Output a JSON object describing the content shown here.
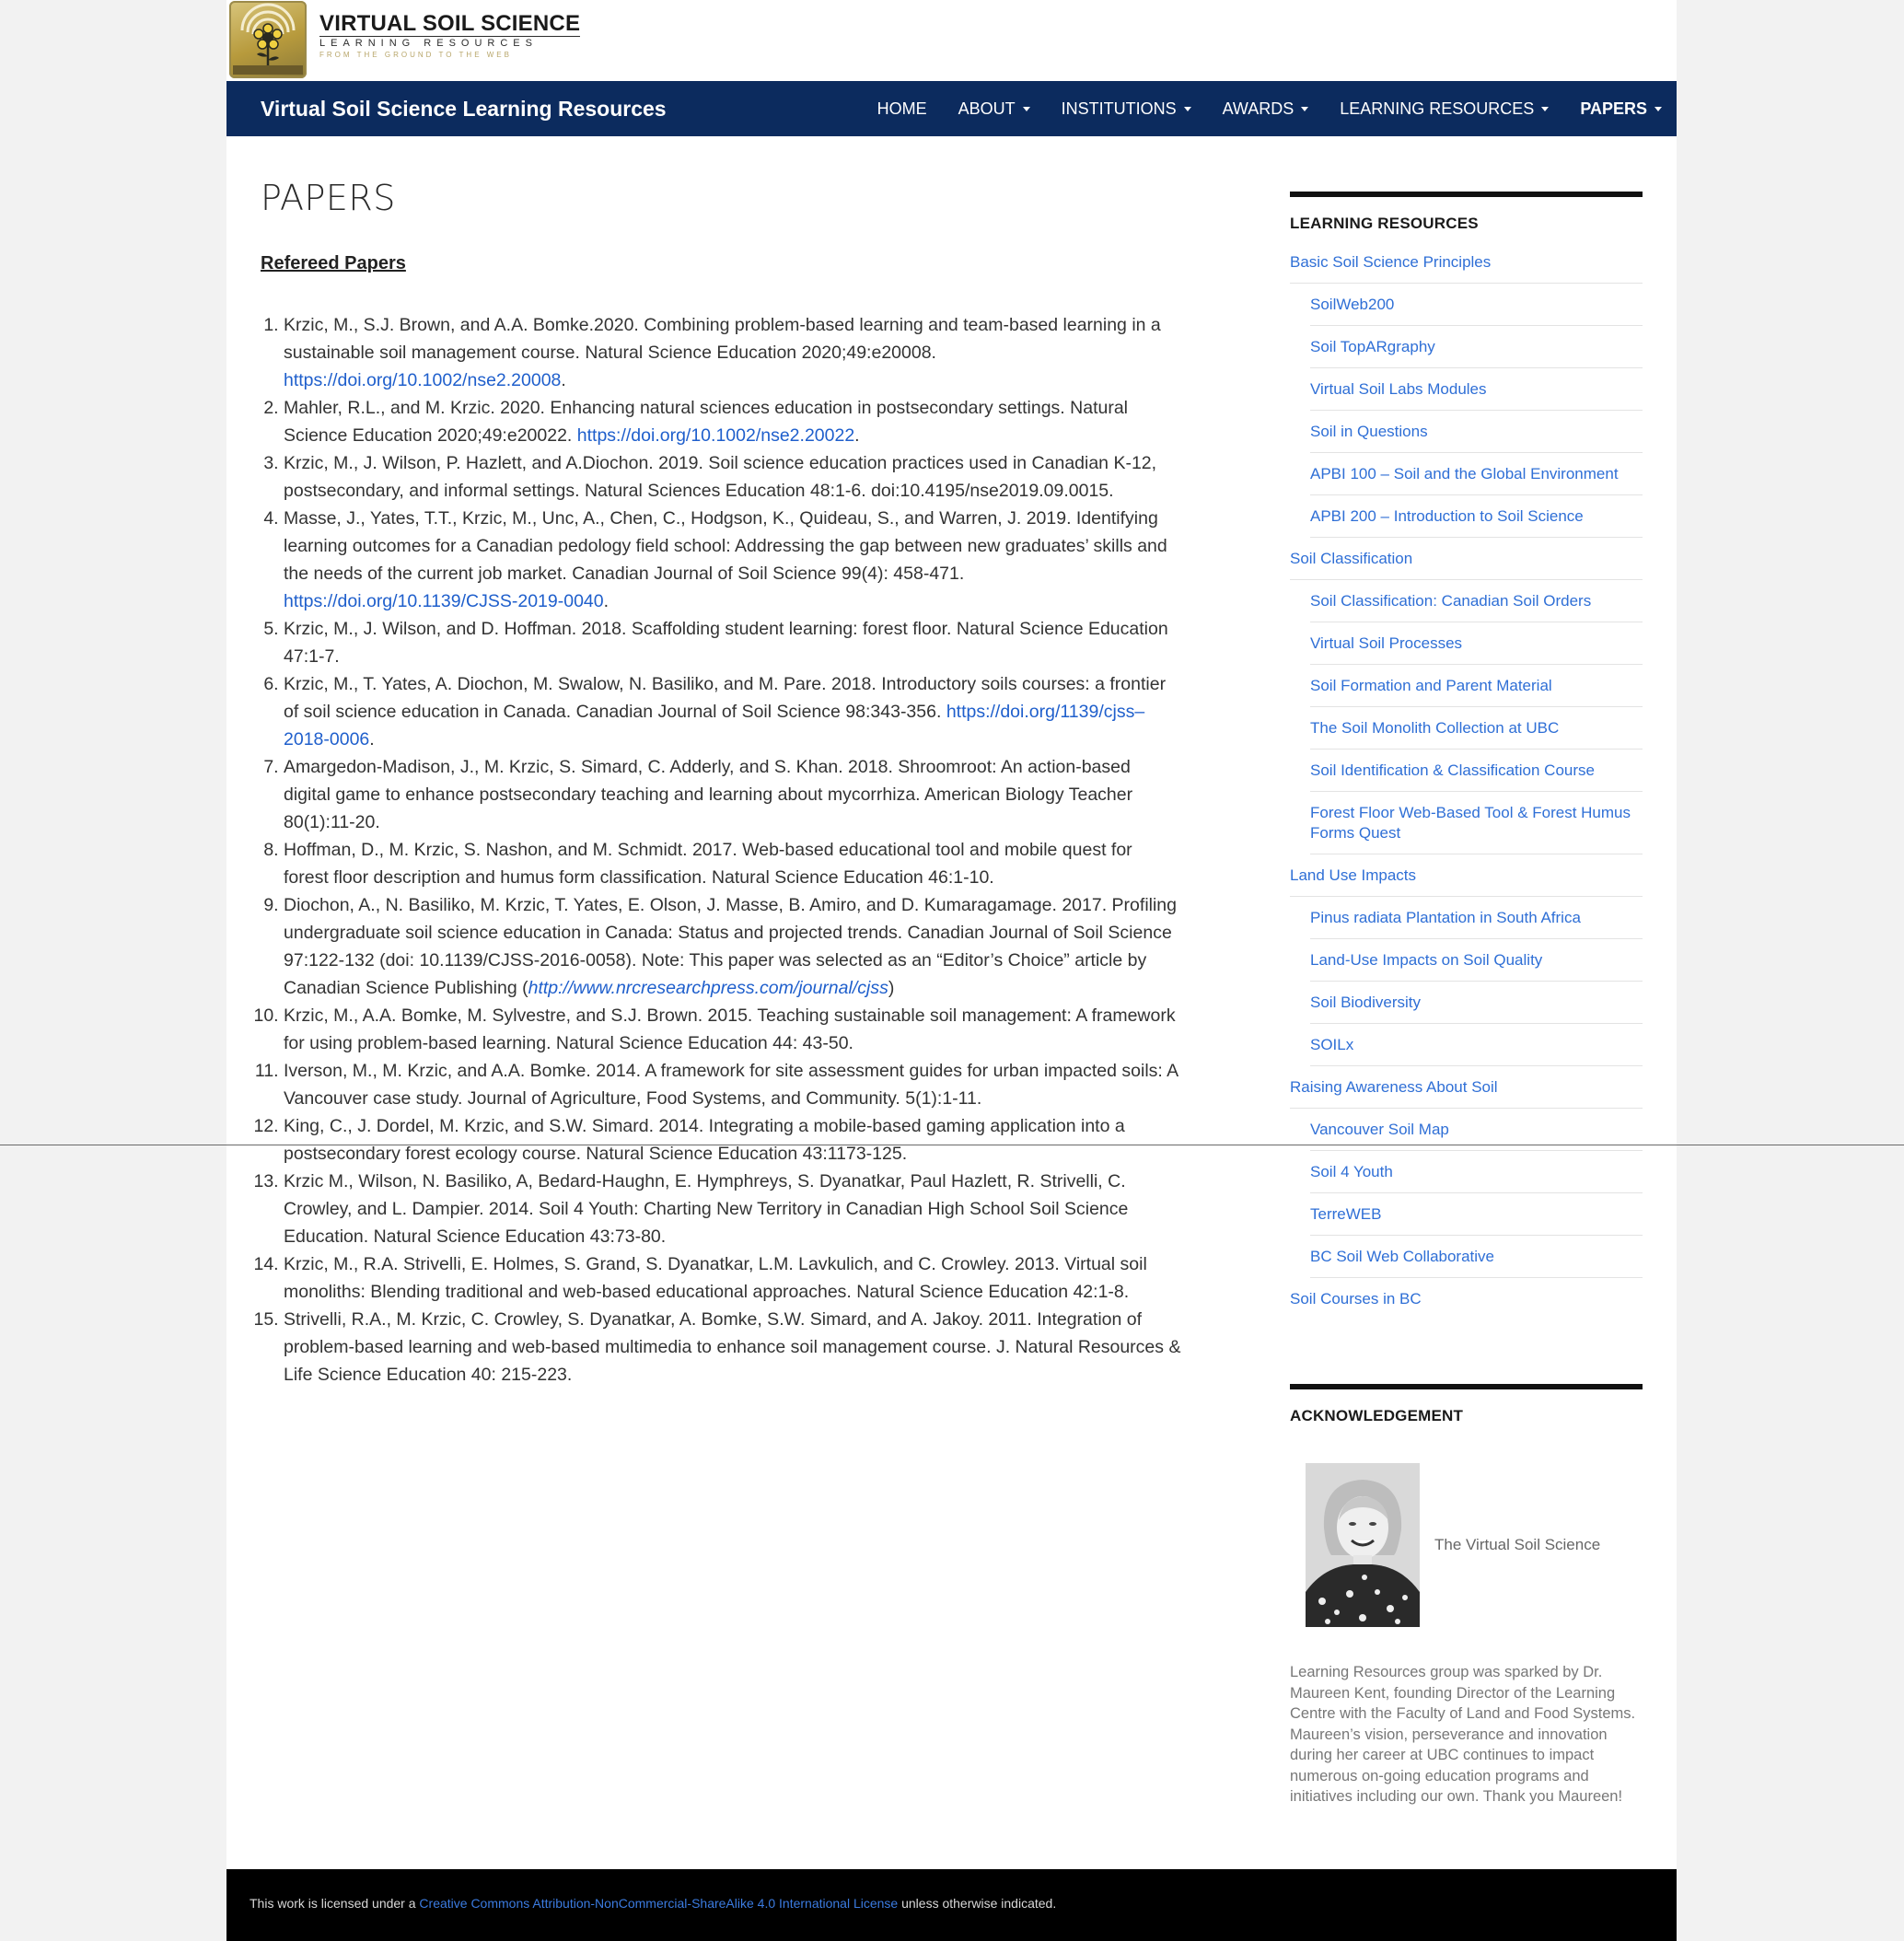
{
  "brand": {
    "title": "VIRTUAL SOIL SCIENCE",
    "subtitle": "LEARNING RESOURCES",
    "tagline": "FROM THE GROUND TO THE WEB"
  },
  "navbar": {
    "site_title": "Virtual Soil Science Learning Resources",
    "menu": [
      {
        "label": "HOME"
      },
      {
        "label": "ABOUT"
      },
      {
        "label": "INSTITUTIONS"
      },
      {
        "label": "AWARDS"
      },
      {
        "label": "LEARNING RESOURCES"
      },
      {
        "label": "PAPERS"
      }
    ]
  },
  "main": {
    "title": "PAPERS",
    "section_heading": "Refereed Papers",
    "papers": [
      {
        "text": "Krzic, M., S.J. Brown, and A.A. Bomke.2020. Combining problem-based learning and team-based learning in a sustainable soil management course. Natural Science Education 2020;49:e20008. ",
        "link": "https://doi.org/10.1002/nse2.20008",
        "after": "."
      },
      {
        "text": "Mahler, R.L., and M. Krzic. 2020. Enhancing natural sciences education in postsecondary settings. Natural Science Education 2020;49:e20022. ",
        "link": "https://doi.org/10.1002/nse2.20022",
        "after": "."
      },
      {
        "text": "Krzic, M., J. Wilson, P. Hazlett, and A.Diochon. 2019. Soil science education practices used in Canadian K-12, postsecondary, and informal settings. Natural Sciences Education 48:1-6. doi:10.4195/nse2019.09.0015.",
        "link": "",
        "after": ""
      },
      {
        "text": "Masse, J., Yates, T.T., Krzic, M., Unc, A., Chen, C., Hodgson, K., Quideau, S., and Warren, J. 2019. Identifying learning outcomes for a Canadian pedology field school: Addressing the gap between new graduates’ skills and the needs of the current job market. Canadian Journal of Soil Science 99(4): 458-471. ",
        "link": "https://doi.org/10.1139/CJSS-2019-0040",
        "after": "."
      },
      {
        "text": "Krzic, M., J. Wilson, and D. Hoffman. 2018. Scaffolding student learning: forest floor. Natural Science Education 47:1-7.",
        "link": "",
        "after": ""
      },
      {
        "text": "Krzic, M., T. Yates, A. Diochon, M. Swalow, N. Basiliko, and M. Pare. 2018. Introductory soils courses: a frontier of soil science education in Canada. Canadian Journal of Soil Science 98:343-356. ",
        "link": "https://doi.org/1139/cjss–2018-0006",
        "after": "."
      },
      {
        "text": "Amargedon-Madison, J., M. Krzic, S. Simard, C. Adderly, and S. Khan. 2018. Shroomroot: An action-based digital game to enhance postsecondary teaching and learning about mycorrhiza. American Biology Teacher 80(1):11-20.",
        "link": "",
        "after": ""
      },
      {
        "text": "Hoffman, D., M. Krzic, S. Nashon, and M. Schmidt. 2017. Web-based educational tool and mobile quest for forest floor description and humus form classification. Natural Science Education 46:1-10.",
        "link": "",
        "after": ""
      },
      {
        "text": "Diochon, A., N. Basiliko, M. Krzic, T. Yates, E. Olson, J. Masse, B. Amiro, and D. Kumaragamage. 2017. Profiling undergraduate soil science education in Canada: Status and projected trends. Canadian Journal of Soil Science 97:122-132 (doi: 10.1139/CJSS-2016-0058). Note: This paper was selected as an “Editor’s Choice” article by Canadian Science Publishing (",
        "link": "http://www.nrcresearchpress.com/journal/cjss",
        "after": ")"
      },
      {
        "text": "Krzic, M., A.A. Bomke, M. Sylvestre, and S.J. Brown. 2015. Teaching sustainable soil management: A framework for using problem-based learning. Natural Science Education 44: 43-50.",
        "link": "",
        "after": ""
      },
      {
        "text": "Iverson, M., M. Krzic, and A.A. Bomke. 2014. A framework for site assessment guides for urban impacted soils: A Vancouver case study. Journal of Agriculture, Food Systems, and Community. 5(1):1-11.",
        "link": "",
        "after": ""
      },
      {
        "text": "King, C., J. Dordel, M. Krzic, and S.W. Simard. 2014. Integrating a mobile-based gaming application into a postsecondary forest ecology course. Natural Science Education 43:1173-125.",
        "link": "",
        "after": ""
      },
      {
        "text": "Krzic M., Wilson, N. Basiliko, A, Bedard-Haughn, E. Hymphreys, S. Dyanatkar, Paul Hazlett, R. Strivelli, C. Crowley, and L. Dampier. 2014. Soil 4 Youth: Charting New Territory in Canadian High School Soil Science Education. Natural Science Education 43:73-80.",
        "link": "",
        "after": ""
      },
      {
        "text": "Krzic, M., R.A. Strivelli, E. Holmes, S. Grand, S. Dyanatkar, L.M. Lavkulich, and C. Crowley. 2013. Virtual soil monoliths: Blending traditional and web-based educational approaches. Natural Science Education 42:1-8.",
        "link": "",
        "after": ""
      },
      {
        "text": "Strivelli, R.A., M. Krzic, C. Crowley, S. Dyanatkar, A. Bomke, S.W. Simard, and A. Jakoy. 2011. Integration of problem-based learning and web-based multimedia to enhance soil management course. J. Natural Resources & Life Science Education 40: 215-223.",
        "link": "",
        "after": ""
      }
    ]
  },
  "sidebar": {
    "learning_title": "LEARNING RESOURCES",
    "items": [
      {
        "label": "Basic Soil Science Principles",
        "level": 0
      },
      {
        "label": "SoilWeb200",
        "level": 1
      },
      {
        "label": "Soil TopARgraphy",
        "level": 1
      },
      {
        "label": "Virtual Soil Labs Modules",
        "level": 1
      },
      {
        "label": "Soil in Questions",
        "level": 1
      },
      {
        "label": "APBI 100 – Soil and the Global Environment",
        "level": 1
      },
      {
        "label": "APBI 200 – Introduction to Soil Science",
        "level": 1
      },
      {
        "label": "Soil Classification",
        "level": 0
      },
      {
        "label": "Soil Classification: Canadian Soil Orders",
        "level": 1
      },
      {
        "label": "Virtual Soil Processes",
        "level": 1
      },
      {
        "label": "Soil Formation and Parent Material",
        "level": 1
      },
      {
        "label": "The Soil Monolith Collection at UBC",
        "level": 1
      },
      {
        "label": "Soil Identification & Classification Course",
        "level": 1
      },
      {
        "label": "Forest Floor Web-Based Tool & Forest Humus Forms Quest",
        "level": 1
      },
      {
        "label": "Land Use Impacts",
        "level": 0
      },
      {
        "label": "Pinus radiata Plantation in South Africa",
        "level": 1
      },
      {
        "label": "Land-Use Impacts on Soil Quality",
        "level": 1
      },
      {
        "label": "Soil Biodiversity",
        "level": 1
      },
      {
        "label": "SOILx",
        "level": 1
      },
      {
        "label": "Raising Awareness About Soil",
        "level": 0
      },
      {
        "label": "Vancouver Soil Map",
        "level": 1
      },
      {
        "label": "Soil 4 Youth",
        "level": 1
      },
      {
        "label": "TerreWEB",
        "level": 1
      },
      {
        "label": "BC Soil Web Collaborative",
        "level": 1
      },
      {
        "label": "Soil Courses in BC",
        "level": 0
      }
    ],
    "ack_title": "ACKNOWLEDGEMENT",
    "ack_inline": "The Virtual Soil Science",
    "ack_text": "Learning Resources group was sparked by Dr. Maureen Kent, founding Director of the Learning Centre with the Faculty of Land and Food Systems. Maureen’s vision, perseverance and innovation during her career at UBC continues to impact numerous on-going education programs and initiatives including our own. Thank you Maureen!"
  },
  "footer": {
    "prefix": "This work is licensed under a ",
    "link": "Creative Commons Attribution-NonCommercial-ShareAlike 4.0 International License",
    "suffix": " unless otherwise indicated."
  },
  "colors": {
    "navbar": "#0c2b5e",
    "link": "#2f6fd6",
    "footer": "#000000"
  }
}
